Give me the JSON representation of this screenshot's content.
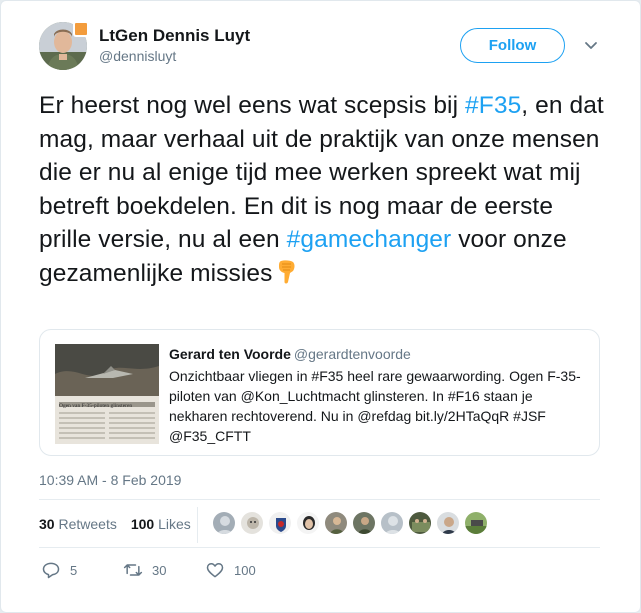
{
  "author": {
    "display_name": "LtGen Dennis Luyt",
    "screen_name": "@dennisluyt",
    "avatar_icon": "profile-photo"
  },
  "header": {
    "follow_label": "Follow",
    "more_icon": "chevron-down-icon"
  },
  "tweet": {
    "parts": [
      {
        "text": "Er heerst nog wel eens wat scepsis bij ",
        "type": "text"
      },
      {
        "text": "#F35",
        "type": "hashtag"
      },
      {
        "text": ", en dat mag, maar verhaal uit de praktijk van onze mensen die er nu al enige tijd mee werken spreekt wat mij betreft boekdelen. En dit is nog maar de eerste prille versie, nu al een ",
        "type": "text"
      },
      {
        "text": "#gamechanger",
        "type": "hashtag"
      },
      {
        "text": " voor onze gezamenlijke missies",
        "type": "text"
      }
    ],
    "emoji": "backhand-index-pointing-down"
  },
  "quote": {
    "name": "Gerard ten Voorde",
    "handle": "@gerardtenvoorde",
    "text": "Onzichtbaar vliegen in #F35 heel rare gewaarwording. Ogen F-35-piloten van @Kon_Luchtmacht glinsteren. In #F16 staan je nekharen rechtoverend. Nu in @refdag bit.ly/2HTaQqR #JSF @F35_CFTT",
    "thumbnail_headline": "Ogen van F-35-piloten glinsteren"
  },
  "timestamp": "10:39 AM - 8 Feb 2019",
  "stats": {
    "retweets_count": "30",
    "retweets_label": "Retweets",
    "likes_count": "100",
    "likes_label": "Likes"
  },
  "actions": {
    "reply_count": "5",
    "retweet_count": "30",
    "like_count": "100"
  },
  "colors": {
    "accent": "#1da1f2",
    "secondary_text": "#657786",
    "border": "#e1e8ed"
  }
}
